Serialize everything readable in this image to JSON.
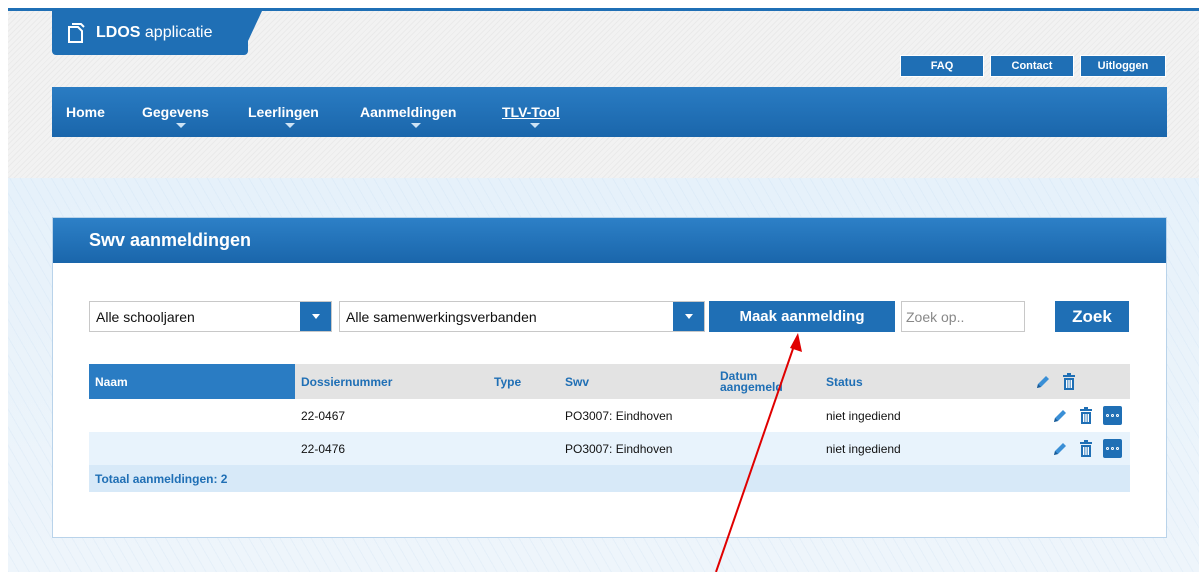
{
  "app": {
    "title_bold": "LDOS",
    "title_rest": " applicatie"
  },
  "top_buttons": {
    "faq": "FAQ",
    "contact": "Contact",
    "logout": "Uitloggen"
  },
  "nav": [
    "Home",
    "Gegevens",
    "Leerlingen",
    "Aanmeldingen",
    "TLV-Tool"
  ],
  "panel": {
    "title": "Swv aanmeldingen"
  },
  "filters": {
    "schoolyear": "Alle schooljaren",
    "swv": "Alle samenwerkingsverbanden",
    "create_button": "Maak aanmelding",
    "search_placeholder": "Zoek op..",
    "search_button": "Zoek"
  },
  "table": {
    "headers": {
      "naam": "Naam",
      "dossier": "Dossiernummer",
      "type": "Type",
      "swv": "Swv",
      "datum": "Datum aangemeld",
      "status": "Status"
    },
    "rows": [
      {
        "naam": "",
        "dossier": "22-0467",
        "type": "",
        "swv": "PO3007: Eindhoven",
        "datum": "",
        "status": "niet ingediend"
      },
      {
        "naam": "",
        "dossier": "22-0476",
        "type": "",
        "swv": "PO3007: Eindhoven",
        "datum": "",
        "status": "niet ingediend"
      }
    ],
    "total": "Totaal aanmeldingen: 2"
  },
  "colors": {
    "primary": "#1f6fb5",
    "annotation_arrow": "#e00000"
  }
}
